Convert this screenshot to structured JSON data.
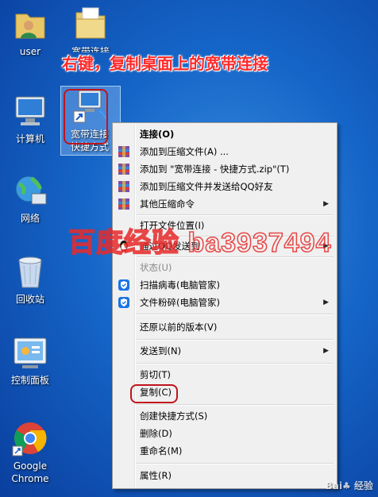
{
  "desktop": {
    "icons": [
      {
        "label": "user"
      },
      {
        "label": "宽带连接"
      },
      {
        "label": "计算机"
      },
      {
        "label": "宽带连接 快捷方式"
      },
      {
        "label": "网络"
      },
      {
        "label": "回收站"
      },
      {
        "label": "控制面板"
      },
      {
        "label": "Google Chrome"
      }
    ],
    "selected_label_line1": "宽带连接",
    "selected_label_line2": "快捷方式"
  },
  "annotation": {
    "instruction": "右键，复制桌面上的宽带连接",
    "watermark": "百度经验 ba3937494",
    "logo": "Bai♣ 经验"
  },
  "context_menu": {
    "items": [
      {
        "label": "连接(O)"
      },
      {
        "label": "添加到压缩文件(A) ..."
      },
      {
        "label": "添加到 \"宽带连接 - 快捷方式.zip\"(T)"
      },
      {
        "label": "添加到压缩文件并发送给QQ好友"
      },
      {
        "label": "其他压缩命令"
      },
      {
        "label": "打开文件位置(I)"
      },
      {
        "label": "通过QQ发送到"
      },
      {
        "label": "状态(U)"
      },
      {
        "label": "扫描病毒(电脑管家)"
      },
      {
        "label": "文件粉碎(电脑管家)"
      },
      {
        "label": "还原以前的版本(V)"
      },
      {
        "label": "发送到(N)"
      },
      {
        "label": "剪切(T)"
      },
      {
        "label": "复制(C)"
      },
      {
        "label": "创建快捷方式(S)"
      },
      {
        "label": "删除(D)"
      },
      {
        "label": "重命名(M)"
      },
      {
        "label": "属性(R)"
      }
    ]
  },
  "colors": {
    "desktop": "#1565c8",
    "highlight_red": "#c0141c",
    "annotation_red": "#ff2a2a"
  }
}
